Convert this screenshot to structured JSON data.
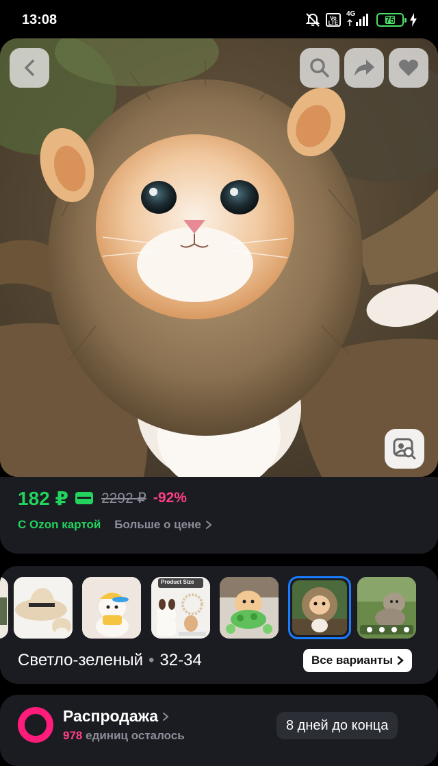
{
  "status_bar": {
    "time": "13:08",
    "network_label": "4G",
    "volte_label": "Vo LTE",
    "battery_percent": "75",
    "icons": [
      "muted-bell-icon",
      "volte-icon",
      "signal-icon",
      "battery-icon",
      "charging-icon"
    ]
  },
  "hero": {
    "buttons": [
      "back-icon",
      "search-icon",
      "share-icon",
      "heart-icon",
      "image-search-icon"
    ]
  },
  "price": {
    "current": "182 ₽",
    "old": "2292 ₽",
    "discount": "-92%",
    "ozon_card": "С Ozon картой",
    "more_about_price": "Больше о цене"
  },
  "variants": {
    "color": "Светло-зеленый",
    "size": "32-34",
    "all_variants": "Все варианты",
    "thumb_text": "Product Size",
    "selected_index": 5
  },
  "sale": {
    "title": "Распродажа",
    "count": "978",
    "count_suffix": "единиц осталось",
    "days_left": "8 дней до конца"
  },
  "colors": {
    "green": "#22d35d",
    "pink": "#ff3f87",
    "blue": "#1a7cff",
    "card_bg": "#1b1c22"
  }
}
